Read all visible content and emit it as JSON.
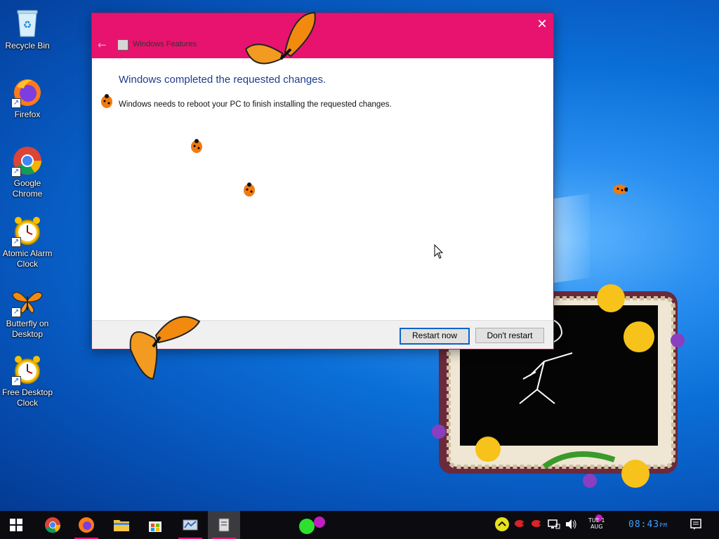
{
  "desktop": {
    "icons": [
      {
        "label": "Recycle Bin"
      },
      {
        "label": "Firefox"
      },
      {
        "label": "Google Chrome"
      },
      {
        "label": "Atomic Alarm Clock"
      },
      {
        "label": "Butterfly on Desktop"
      },
      {
        "label": "Free Desktop Clock"
      }
    ]
  },
  "dialog": {
    "title": "Windows Features",
    "heading": "Windows completed the requested changes.",
    "message": "Windows needs to reboot your PC to finish installing the requested changes.",
    "restart_label": "Restart now",
    "dont_restart_label": "Don't restart",
    "accent_color": "#e8136e"
  },
  "taskbar": {
    "items": [
      "start",
      "chrome",
      "firefox",
      "file-explorer",
      "microsoft-store",
      "control-panel",
      "windows-features"
    ],
    "date_day": "TUE",
    "date_month": "AUG",
    "date_num": "1",
    "time": "08:43",
    "ampm": "PM"
  }
}
